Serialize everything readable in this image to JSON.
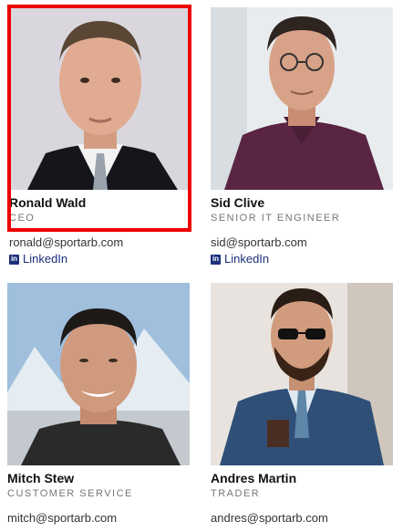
{
  "team": [
    {
      "name": "Ronald Wald",
      "role": "CEO",
      "email": "ronald@sportarb.com",
      "linkedin": "LinkedIn"
    },
    {
      "name": "Sid Clive",
      "role": "SENIOR IT ENGINEER",
      "email": "sid@sportarb.com",
      "linkedin": "LinkedIn"
    },
    {
      "name": "Mitch Stew",
      "role": "CUSTOMER SERVICE",
      "email": "mitch@sportarb.com"
    },
    {
      "name": "Andres Martin",
      "role": "TRADER",
      "email": "andres@sportarb.com"
    }
  ],
  "icons": {
    "linkedin": "linkedin-icon"
  },
  "colors": {
    "highlight": "#ee0000",
    "link": "#1b2f7a"
  }
}
